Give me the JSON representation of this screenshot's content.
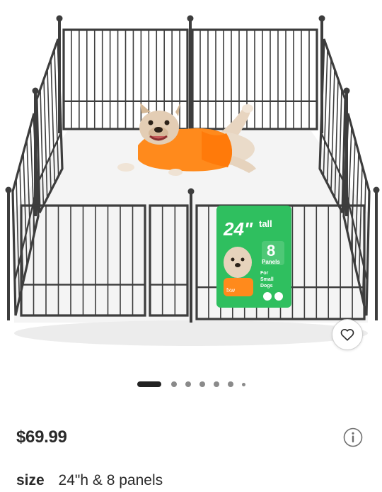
{
  "product": {
    "image_alt": "Dog playpen with french bulldog",
    "badge": {
      "height_text": "24\"",
      "tall_text": "tall",
      "panel_count": "8",
      "panels_text": "Panels",
      "usage_text": [
        "For",
        "Small",
        "Dogs"
      ],
      "brand_text": "fxw"
    }
  },
  "carousel": {
    "total_dots": 7,
    "active_index": 0
  },
  "price": "$69.99",
  "size": {
    "label": "size",
    "value": "24\"h & 8 panels"
  },
  "colors": {
    "fence": "#3d3d3d",
    "badge_green": "#2fbf5f",
    "shirt_orange": "#ff8a1c",
    "text": "#2a2a2a"
  },
  "icons": {
    "favorite": "heart-icon",
    "info": "info-icon"
  }
}
